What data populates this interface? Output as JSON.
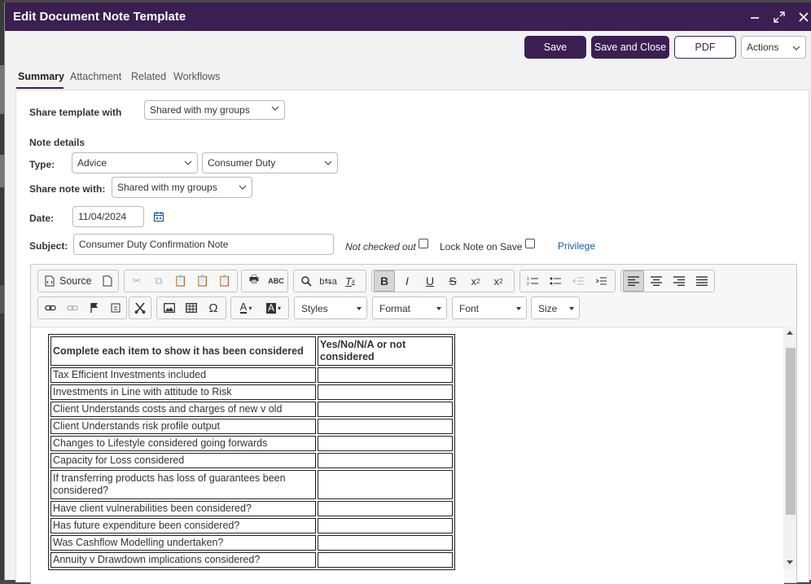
{
  "window": {
    "title": "Edit Document Note Template"
  },
  "actions": {
    "save": "Save",
    "save_close": "Save and Close",
    "pdf": "PDF",
    "actions": "Actions"
  },
  "tabs": [
    "Summary",
    "Attachment",
    "Related",
    "Workflows"
  ],
  "form": {
    "share_template_label": "Share template with",
    "share_template_value": "Shared with my groups",
    "note_details_heading": "Note details",
    "type_label": "Type:",
    "type_value": "Advice",
    "subtype_value": "Consumer Duty",
    "share_note_label": "Share note with:",
    "share_note_value": "Shared with my groups",
    "date_label": "Date:",
    "date_value": "11/04/2024",
    "subject_label": "Subject:",
    "subject_value": "Consumer Duty Confirmation Note",
    "checkout_status": "Not checked out",
    "lock_label": "Lock Note on Save",
    "privilege_link": "Privilege"
  },
  "editor": {
    "source_label": "Source",
    "styles": "Styles",
    "format": "Format",
    "font": "Font",
    "size": "Size"
  },
  "checklist": {
    "header_item": "Complete each item to show it has been considered",
    "header_answer": "Yes/No/N/A or not considered",
    "rows": [
      "Tax Efficient Investments included",
      "Investments in Line with attitude to Risk",
      "Client Understands costs and charges of new v old",
      "Client Understands risk profile output",
      "Changes to Lifestyle considered going forwards",
      "Capacity for Loss considered",
      "If transferring products has loss of guarantees been considered?",
      "Have client vulnerabilities been considered?",
      "Has future expenditure been considered?",
      "Was Cashflow Modelling undertaken?",
      "Annuity v Drawdown implications considered?"
    ]
  },
  "colors": {
    "brand": "#3b1f52",
    "link": "#1a5fa8"
  }
}
